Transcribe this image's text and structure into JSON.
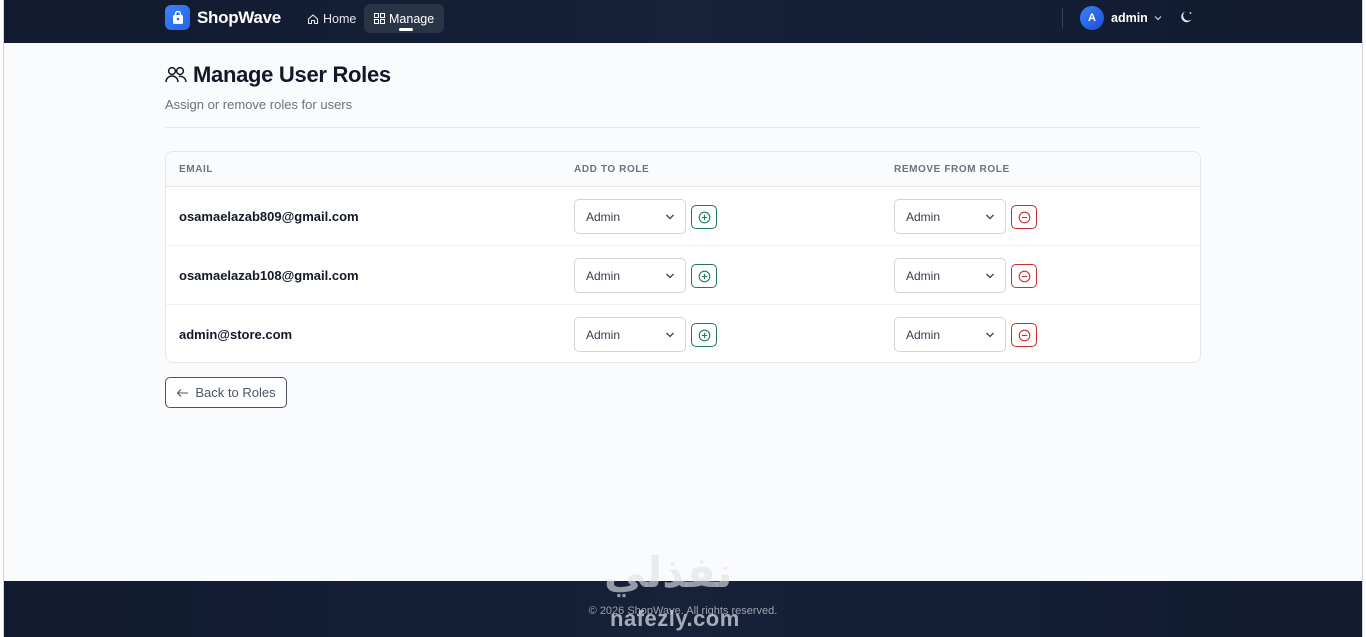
{
  "navbar": {
    "brand": "ShopWave",
    "links": [
      {
        "label": "Home",
        "icon": "home-icon"
      },
      {
        "label": "Manage",
        "icon": "grid-icon",
        "active": true
      }
    ],
    "user": {
      "initial": "A",
      "name": "admin"
    },
    "theme_icon": "moon-icon"
  },
  "page": {
    "title": "Manage User Roles",
    "title_icon": "users-icon",
    "subtitle": "Assign or remove roles for users"
  },
  "table": {
    "headers": {
      "email": "EMAIL",
      "add": "ADD TO ROLE",
      "remove": "REMOVE FROM ROLE"
    },
    "rows": [
      {
        "email": "osamaelazab809@gmail.com",
        "add_role": "Admin",
        "remove_role": "Admin"
      },
      {
        "email": "osamaelazab108@gmail.com",
        "add_role": "Admin",
        "remove_role": "Admin"
      },
      {
        "email": "admin@store.com",
        "add_role": "Admin",
        "remove_role": "Admin"
      }
    ]
  },
  "back_button": {
    "label": "Back to Roles",
    "icon": "arrow-left-icon"
  },
  "footer": {
    "text": "© 2026 ShopWave. All rights reserved."
  },
  "watermark": {
    "arabic": "نفذلي",
    "latin": "nafezly.com"
  },
  "colors": {
    "nav_bg": "#111a2e",
    "accent": "#2563eb",
    "add_green": "#1f7a5a",
    "remove_red": "#c53030"
  }
}
